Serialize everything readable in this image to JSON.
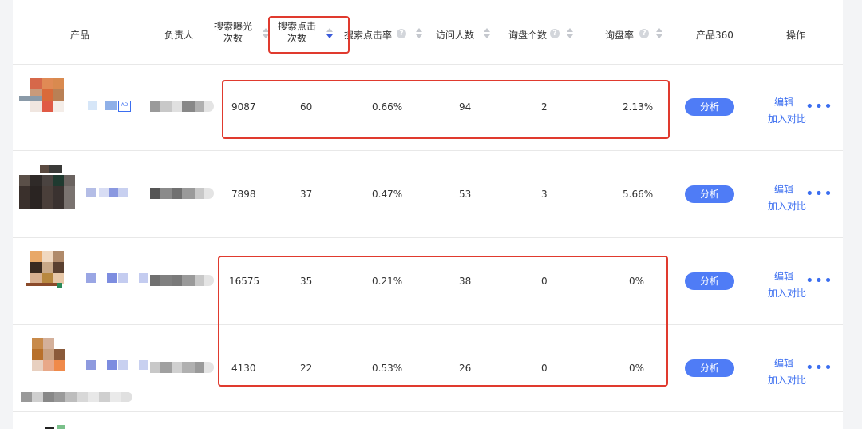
{
  "header": {
    "product": "产品",
    "owner": "负责人",
    "impressions_l1": "搜索曝光",
    "impressions_l2": "次数",
    "clicks_l1": "搜索点击",
    "clicks_l2": "次数",
    "ctr": "搜索点击率",
    "visitors": "访问人数",
    "inquiries": "询盘个数",
    "inquiry_rate": "询盘率",
    "product360": "产品360",
    "actions": "操作",
    "help_glyph": "?"
  },
  "rows": [
    {
      "impressions": "9087",
      "clicks": "60",
      "ctr": "0.66%",
      "visitors": "94",
      "inquiries": "2",
      "inquiry_rate": "2.13%",
      "ad_badge": "AD"
    },
    {
      "impressions": "7898",
      "clicks": "37",
      "ctr": "0.47%",
      "visitors": "53",
      "inquiries": "3",
      "inquiry_rate": "5.66%"
    },
    {
      "impressions": "16575",
      "clicks": "35",
      "ctr": "0.21%",
      "visitors": "38",
      "inquiries": "0",
      "inquiry_rate": "0%"
    },
    {
      "impressions": "4130",
      "clicks": "22",
      "ctr": "0.53%",
      "visitors": "26",
      "inquiries": "0",
      "inquiry_rate": "0%"
    }
  ],
  "actions": {
    "analyze": "分析",
    "edit": "编辑",
    "compare": "加入对比",
    "more": "•••"
  },
  "icons": {
    "sort": "sort-icon",
    "help": "help-icon",
    "more": "more-icon"
  },
  "colors": {
    "accent": "#4f7cf6",
    "link": "#3b6ef0",
    "highlight": "#e03a2e",
    "sort_active": "#3b5bdb"
  }
}
